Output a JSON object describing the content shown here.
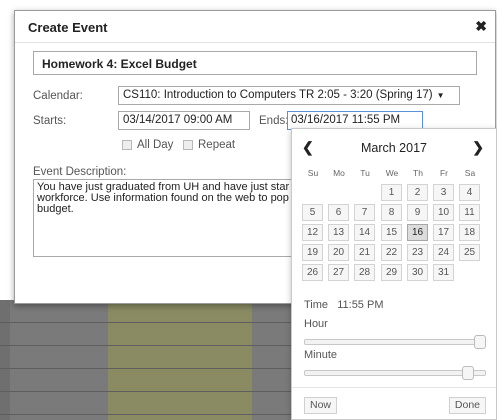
{
  "dialog": {
    "title": "Create Event",
    "close_icon": "close-icon",
    "event_title": "Homework 4: Excel Budget",
    "calendar_label": "Calendar:",
    "calendar_value": "CS110: Introduction to Computers TR 2:05 - 3:20 (Spring 17)",
    "starts_label": "Starts:",
    "starts_value": "03/14/2017 09:00 AM",
    "ends_label": "Ends:",
    "ends_value": "03/16/2017 11:55 PM",
    "all_day_label": "All Day",
    "repeat_label": "Repeat",
    "description_label": "Event Description:",
    "description_value": "You have just graduated from UH and have just star\nworkforce. Use information found on the web to pop\nbudget."
  },
  "picker": {
    "prev_icon": "chevron-left-icon",
    "next_icon": "chevron-right-icon",
    "month": "March 2017",
    "weekdays": [
      "Su",
      "Mo",
      "Tu",
      "We",
      "Th",
      "Fr",
      "Sa"
    ],
    "days": [
      "1",
      "2",
      "3",
      "4",
      "5",
      "6",
      "7",
      "8",
      "9",
      "10",
      "11",
      "12",
      "13",
      "14",
      "15",
      "16",
      "17",
      "18",
      "19",
      "20",
      "21",
      "22",
      "23",
      "24",
      "25",
      "26",
      "27",
      "28",
      "29",
      "30",
      "31"
    ],
    "first_weekday_index": 3,
    "selected_day": "16",
    "time_label": "Time",
    "time_value": "11:55 PM",
    "hour_label": "Hour",
    "hour_value": 23,
    "minute_label": "Minute",
    "minute_value": 55,
    "now_label": "Now",
    "done_label": "Done"
  }
}
